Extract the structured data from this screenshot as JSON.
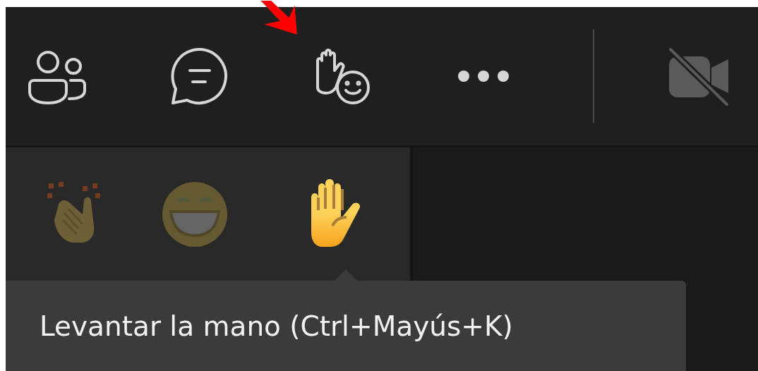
{
  "toolbar": {
    "buttons": [
      {
        "kind": "people",
        "disabled": false
      },
      {
        "kind": "chat",
        "disabled": false
      },
      {
        "kind": "react",
        "disabled": false
      },
      {
        "kind": "more",
        "disabled": false
      },
      {
        "kind": "camera",
        "disabled": true
      }
    ]
  },
  "reactions": [
    {
      "kind": "applause",
      "highlighted": false
    },
    {
      "kind": "laugh",
      "highlighted": false
    },
    {
      "kind": "raise-hand",
      "highlighted": true
    }
  ],
  "tooltip": {
    "text": "Levantar la mano (Ctrl+Mayús+K)"
  }
}
